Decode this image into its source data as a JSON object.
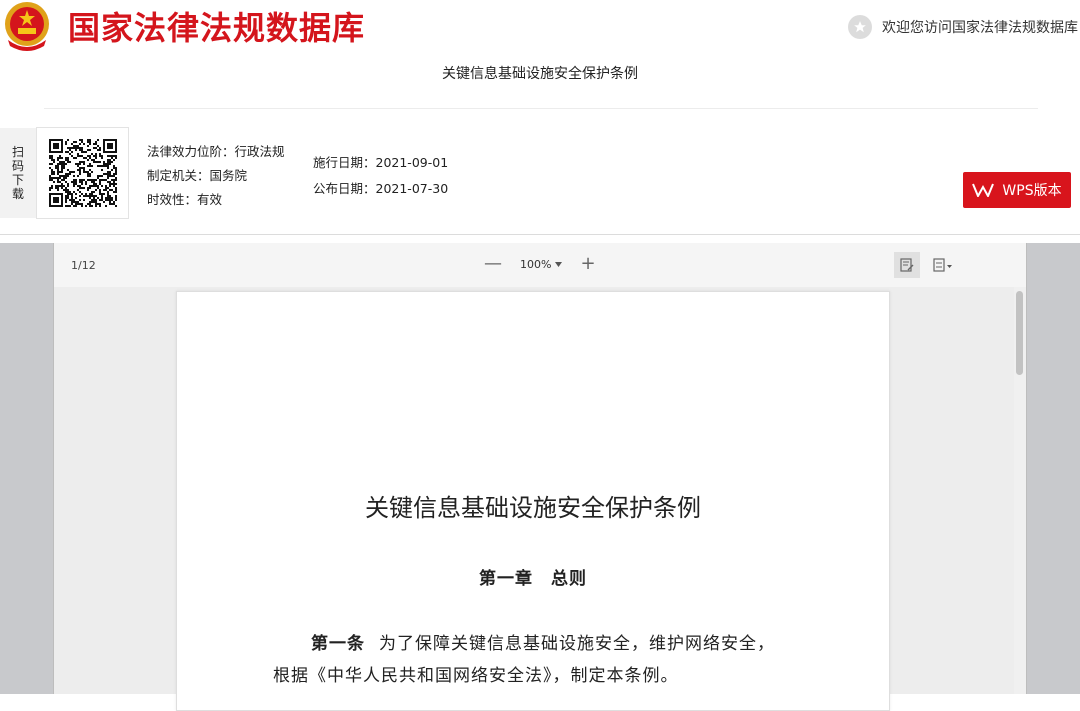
{
  "header": {
    "site_title": "国家法律法规数据库",
    "welcome_text": "欢迎您访问国家法律法规数据库",
    "brand_color": "#d4151c"
  },
  "document": {
    "heading": "关键信息基础设施安全保护条例"
  },
  "info": {
    "scan_tab": [
      "扫",
      "码",
      "下",
      "载"
    ],
    "level": "法律效力位阶：行政法规",
    "authority": "制定机关：国务院",
    "validity": "时效性：有效",
    "effective_date": "施行日期：2021-09-01",
    "publish_date": "公布日期：2021-07-30",
    "wps_button": "WPS版本"
  },
  "viewer": {
    "page_indicator": "1/12",
    "zoom_out": "—",
    "zoom_level": "100%",
    "zoom_in": "+",
    "icons": [
      "edit-icon",
      "page-layout-icon"
    ],
    "page": {
      "title": "关键信息基础设施安全保护条例",
      "chapter": "第一章　总则",
      "article_lead": "第一条",
      "article_line1": "为了保障关键信息基础设施安全，维护网络安全，",
      "article_line2": "根据《中华人民共和国网络安全法》，制定本条例。"
    }
  }
}
